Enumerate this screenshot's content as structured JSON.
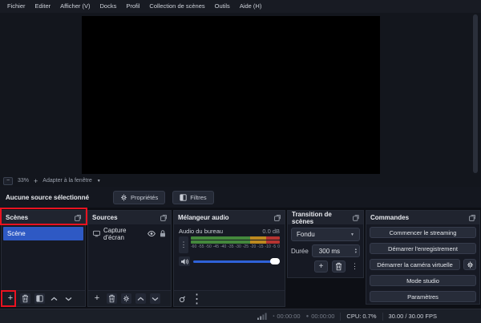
{
  "colors": {
    "annotation-red": "#ea1220",
    "accent-blue": "#2e59c4",
    "slider-blue": "#2f62d8",
    "meter-green": "#44883c",
    "meter-orange": "#bd891f",
    "meter-red": "#b53431"
  },
  "icons": {
    "plus": "+",
    "minus": "−",
    "caret_down": "▼",
    "dots_vertical": "⋮",
    "spin_up": "▴",
    "spin_down": "▾",
    "record_dot": "●",
    "stream_dot": "▪"
  },
  "menu": {
    "items": [
      "Fichier",
      "Editer",
      "Afficher (V)",
      "Docks",
      "Profil",
      "Collection de scènes",
      "Outils",
      "Aide (H)"
    ]
  },
  "preview": {
    "zoom_level": "33%",
    "fit_label": "Adapter à la fenêtre"
  },
  "context_bar": {
    "status": "Aucune source sélectionné",
    "properties_label": "Propriétés",
    "filters_label": "Filtres"
  },
  "scenes": {
    "title": "Scènes",
    "items": [
      {
        "label": "Scène"
      }
    ]
  },
  "sources": {
    "title": "Sources",
    "items": [
      {
        "label": "Capture d'écran"
      }
    ]
  },
  "mixer": {
    "title": "Mélangeur audio",
    "channel": {
      "name": "Audio du bureau",
      "level": "0.0 dB",
      "ticks": [
        "-60",
        "-55",
        "-50",
        "-45",
        "-40",
        "-35",
        "-30",
        "-25",
        "-20",
        "-15",
        "-10",
        "-5",
        "0"
      ]
    }
  },
  "transition": {
    "title": "Transition de scènes",
    "selected": "Fondu",
    "duration_label": "Durée",
    "duration_value": "300 ms"
  },
  "controls": {
    "title": "Commandes",
    "buttons": [
      "Commencer le streaming",
      "Démarrer l'enregistrement",
      "Démarrer la caméra virtuelle",
      "Mode studio",
      "Paramètres"
    ]
  },
  "statusbar": {
    "stream_time": "00:00:00",
    "record_time": "00:00:00",
    "cpu": "CPU: 0.7%",
    "fps": "30.00 / 30.00 FPS"
  }
}
